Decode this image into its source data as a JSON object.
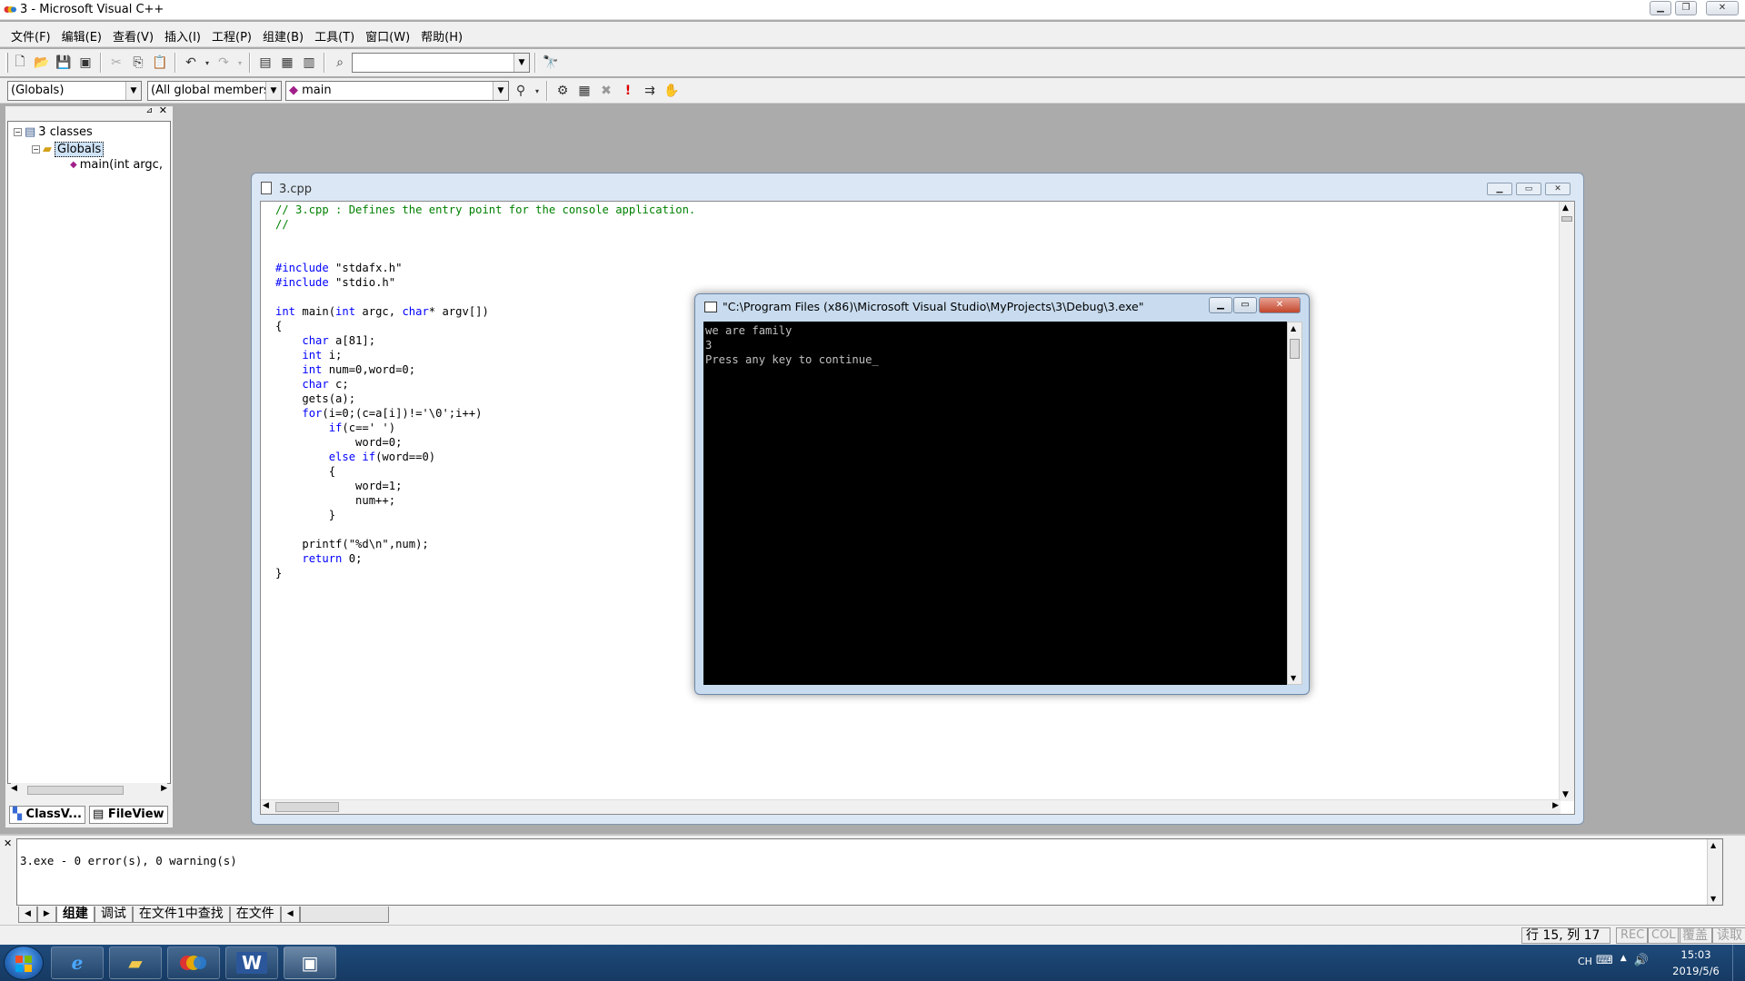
{
  "window": {
    "title": "3 - Microsoft Visual C++"
  },
  "menu": [
    "文件(F)",
    "编辑(E)",
    "查看(V)",
    "插入(I)",
    "工程(P)",
    "组建(B)",
    "工具(T)",
    "窗口(W)",
    "帮助(H)"
  ],
  "toolbar2": {
    "combo_globals": "(Globals)",
    "combo_members": "(All global members",
    "combo_function": "main"
  },
  "workspace": {
    "tree": [
      {
        "label": "3 classes"
      },
      {
        "label": "Globals"
      },
      {
        "label": "main(int argc,"
      }
    ],
    "tabs": {
      "classview": "ClassV...",
      "fileview": "FileView"
    }
  },
  "editor": {
    "title": "3.cpp",
    "lines": [
      [
        {
          "t": "// 3.cpp : Defines the entry point for the console application.",
          "c": "cm"
        }
      ],
      [
        {
          "t": "//",
          "c": "cm"
        }
      ],
      [],
      [],
      [
        {
          "t": "#include",
          "c": "kw"
        },
        {
          "t": " \"stdafx.h\""
        }
      ],
      [
        {
          "t": "#include",
          "c": "kw"
        },
        {
          "t": " \"stdio.h\""
        }
      ],
      [],
      [
        {
          "t": "int",
          "c": "kw"
        },
        {
          "t": " main("
        },
        {
          "t": "int",
          "c": "kw"
        },
        {
          "t": " argc, "
        },
        {
          "t": "char",
          "c": "kw"
        },
        {
          "t": "* argv[])"
        }
      ],
      [
        {
          "t": "{"
        }
      ],
      [
        {
          "t": "    "
        },
        {
          "t": "char",
          "c": "kw"
        },
        {
          "t": " a[81];"
        }
      ],
      [
        {
          "t": "    "
        },
        {
          "t": "int",
          "c": "kw"
        },
        {
          "t": " i;"
        }
      ],
      [
        {
          "t": "    "
        },
        {
          "t": "int",
          "c": "kw"
        },
        {
          "t": " num=0,word=0;"
        }
      ],
      [
        {
          "t": "    "
        },
        {
          "t": "char",
          "c": "kw"
        },
        {
          "t": " c;"
        }
      ],
      [
        {
          "t": "    gets(a);"
        }
      ],
      [
        {
          "t": "    "
        },
        {
          "t": "for",
          "c": "kw"
        },
        {
          "t": "(i=0;(c=a[i])!='\\0';i++)"
        }
      ],
      [
        {
          "t": "        "
        },
        {
          "t": "if",
          "c": "kw"
        },
        {
          "t": "(c==' ')"
        }
      ],
      [
        {
          "t": "            word=0;"
        }
      ],
      [
        {
          "t": "        "
        },
        {
          "t": "else",
          "c": "kw"
        },
        {
          "t": " "
        },
        {
          "t": "if",
          "c": "kw"
        },
        {
          "t": "(word==0)"
        }
      ],
      [
        {
          "t": "        {"
        }
      ],
      [
        {
          "t": "            word=1;"
        }
      ],
      [
        {
          "t": "            num++;"
        }
      ],
      [
        {
          "t": "        }"
        }
      ],
      [],
      [
        {
          "t": "    printf(\"%d\\n\",num);"
        }
      ],
      [
        {
          "t": "    "
        },
        {
          "t": "return",
          "c": "kw"
        },
        {
          "t": " 0;"
        }
      ],
      [
        {
          "t": "}"
        }
      ]
    ]
  },
  "console": {
    "title": "\"C:\\Program Files (x86)\\Microsoft Visual Studio\\MyProjects\\3\\Debug\\3.exe\"",
    "lines": [
      "we are family",
      "3",
      "Press any key to continue_"
    ]
  },
  "output": {
    "text": "3.exe - 0 error(s), 0 warning(s)",
    "tabs": [
      "组建",
      "调试",
      "在文件1中查找",
      "在文件"
    ]
  },
  "status": {
    "position": "行 15, 列 17",
    "rec": "REC",
    "col": "COL",
    "ovr": "覆盖",
    "read": "读取"
  },
  "taskbar": {
    "lang": "CH",
    "time": "15:03",
    "date": "2019/5/6",
    "word_label": "W"
  },
  "colors": {
    "keyword": "#0000ff",
    "comment": "#008000",
    "console_bg": "#000000",
    "taskbar": "#1e4a7a"
  }
}
